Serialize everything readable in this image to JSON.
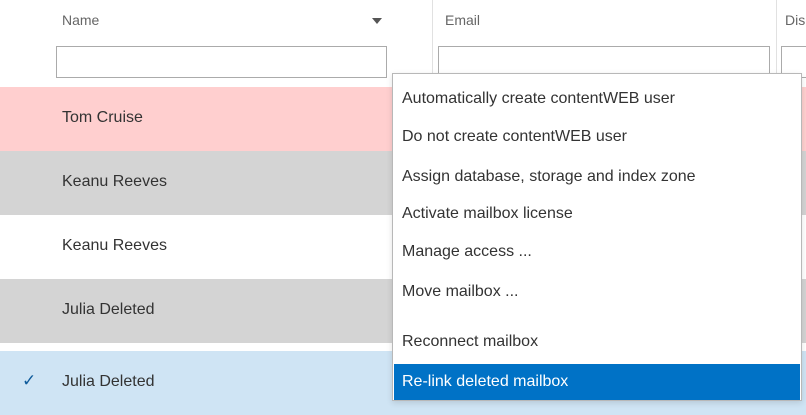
{
  "columns": {
    "name": "Name",
    "email": "Email",
    "third": "Dis"
  },
  "colors": {
    "row_pink": "#ffcfcf",
    "row_gray": "#d4d4d4",
    "row_white": "#ffffff",
    "row_selected": "#cfe4f4",
    "menu_active": "#0072c6"
  },
  "rows": [
    {
      "name": "Tom Cruise",
      "state": "pink"
    },
    {
      "name": "Keanu Reeves",
      "state": "gray"
    },
    {
      "name": "Keanu Reeves",
      "state": "white"
    },
    {
      "name": "Julia Deleted",
      "state": "gray"
    },
    {
      "name": "Julia Deleted",
      "state": "selected",
      "checked": "✓"
    }
  ],
  "context_menu": {
    "items": [
      {
        "label": "Automatically create contentWEB user"
      },
      {
        "label": "Do not create contentWEB user"
      },
      {
        "label": "Assign database, storage and index zone"
      },
      {
        "label": "Activate mailbox license"
      },
      {
        "label": "Manage access ..."
      },
      {
        "label": "Move mailbox ..."
      },
      {
        "label": "Reconnect mailbox"
      },
      {
        "label": "Re-link deleted mailbox",
        "active": true
      }
    ]
  },
  "icons": {
    "sort": "sort-down-icon",
    "check": "checkmark-icon"
  }
}
